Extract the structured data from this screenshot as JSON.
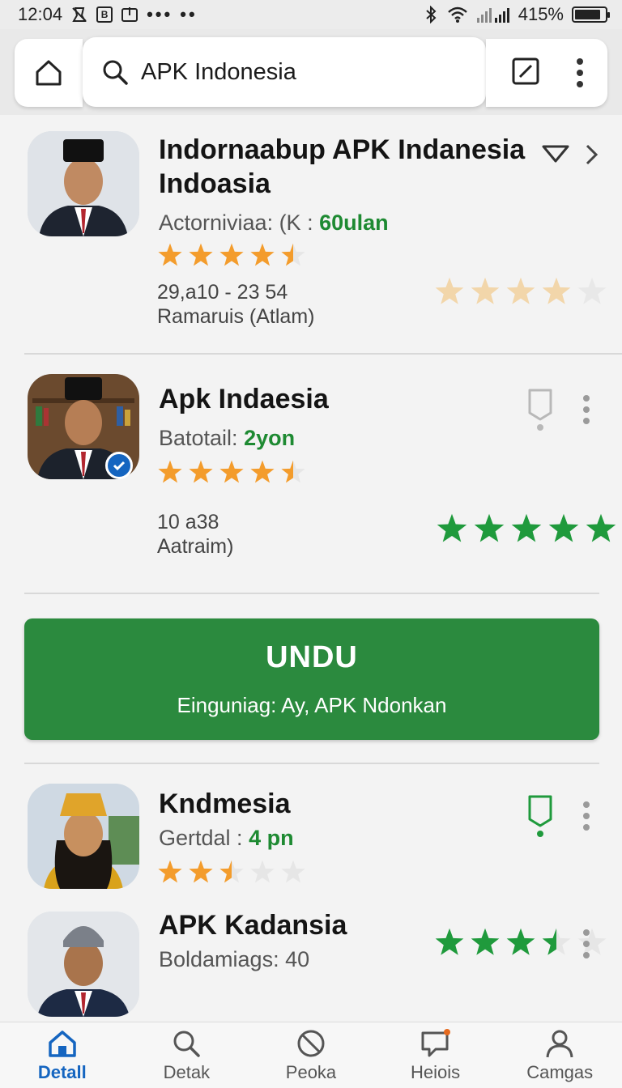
{
  "status": {
    "time": "12:04",
    "battery": "415%",
    "battery_fill": 0.85
  },
  "search": {
    "query": "APK Indonesia"
  },
  "apps": [
    {
      "title_line1": "Indornaabup APK Indanesia",
      "title_line2": "Indoasia",
      "meta_label": "Actorniviaa: (K :",
      "meta_value": "60ulan",
      "rating": 4.5,
      "stats_line1": "29,a10 - 23 54",
      "stats_line2": "Ramaruis (Atlam)",
      "side_rating": 4,
      "side_color": "faded"
    },
    {
      "title_line1": "Apk Indaesia",
      "meta_label": "Batotail:",
      "meta_value": "2yon",
      "rating": 4.5,
      "stats_line1": "10 a38",
      "stats_line2": "Aatraim)",
      "side_rating": 5,
      "side_color": "green"
    },
    {
      "title_line1": "Kndmesia",
      "meta_label": "Gertdal :",
      "meta_value": "4 pn",
      "rating": 2.5
    },
    {
      "title_line1": "APK Kadansia",
      "meta_label": "Boldamiags: 40",
      "side_rating": 3.5,
      "side_color": "green"
    }
  ],
  "banner": {
    "title": "UNDU",
    "subtitle": "Einguniag: Ay, APK Ndonkan"
  },
  "nav": [
    {
      "label": "Detall",
      "icon": "home-icon",
      "active": true
    },
    {
      "label": "Detak",
      "icon": "search-icon",
      "active": false
    },
    {
      "label": "Peoka",
      "icon": "blocked-icon",
      "active": false
    },
    {
      "label": "Heiois",
      "icon": "chat-icon",
      "active": false
    },
    {
      "label": "Camgas",
      "icon": "person-icon",
      "active": false
    }
  ],
  "colors": {
    "accent_green": "#2b8a3e",
    "star_orange": "#f39c2c",
    "star_green": "#1f9a3c",
    "nav_active": "#1565c0"
  }
}
